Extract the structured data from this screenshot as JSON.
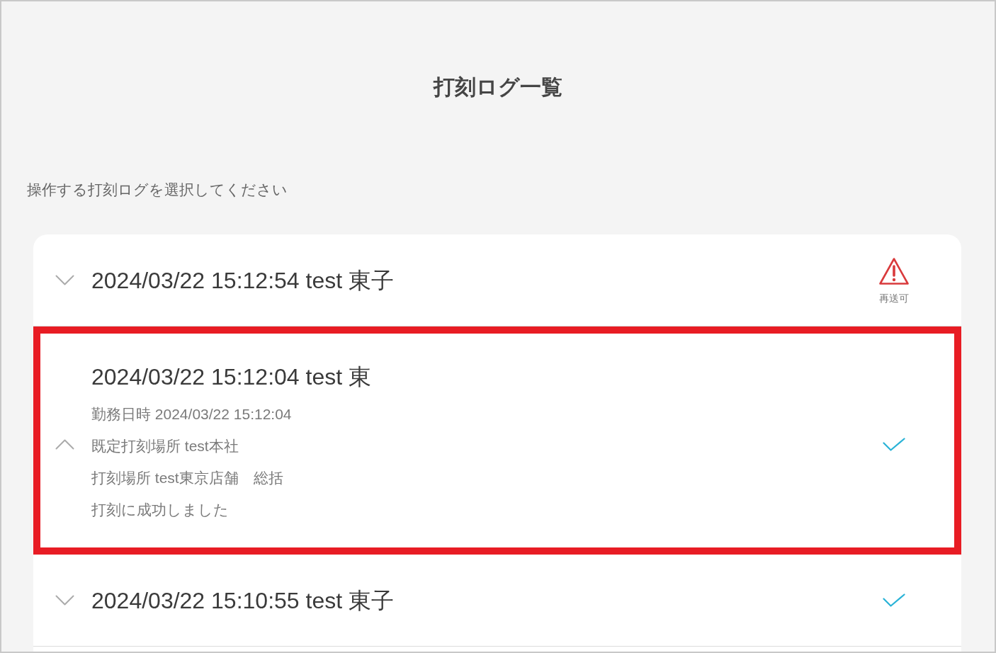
{
  "page": {
    "title": "打刻ログ一覧",
    "instruction": "操作する打刻ログを選択してください"
  },
  "logs": [
    {
      "title": "2024/03/22 15:12:54 test 東子",
      "expanded": false,
      "highlighted": false,
      "status": {
        "kind": "warning",
        "label": "再送可"
      }
    },
    {
      "title": "2024/03/22 15:12:04 test 東",
      "expanded": true,
      "highlighted": true,
      "details": [
        "勤務日時 2024/03/22 15:12:04",
        "既定打刻場所 test本社",
        "打刻場所 test東京店舗　総括",
        "打刻に成功しました"
      ],
      "status": {
        "kind": "success"
      }
    },
    {
      "title": "2024/03/22 15:10:55 test 東子",
      "expanded": false,
      "highlighted": false,
      "status": {
        "kind": "success"
      }
    }
  ]
}
